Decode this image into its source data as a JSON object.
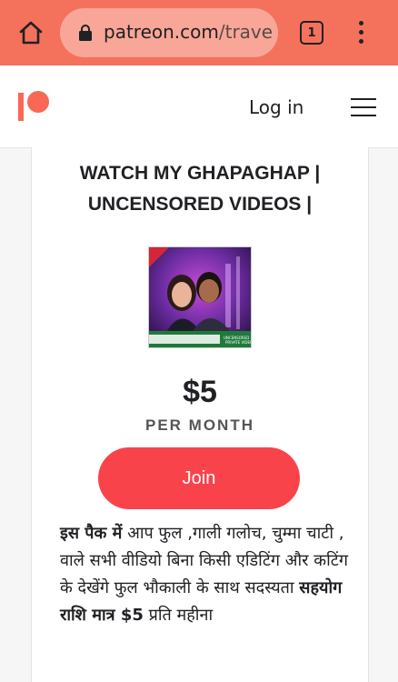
{
  "browser": {
    "url_domain": "patreon.com",
    "url_path": "/trave",
    "tab_count": "1"
  },
  "header": {
    "login_label": "Log in"
  },
  "tier": {
    "title_line1": "WATCH MY GHAPAGHAP |",
    "title_line2": "UNCENSORED VIDEOS |",
    "price": "$5",
    "period": "PER MONTH",
    "join_label": "Join",
    "thumbnail_caption": "UNCENSORED PRIVATE VIDEOS",
    "description": {
      "bold1": "इस पैक में",
      "text1": " आप फुल ,गाली गलोच, चुम्मा चाटी , वाले सभी वीडियो बिना किसी एडिटिंग और कटिंग के देखेंगे फुल भौकाली के साथ सदस्यता ",
      "bold2": "सहयोग राशि मात्र $5",
      "text2": " प्रति महीना"
    }
  },
  "colors": {
    "browser_bar": "#f4725c",
    "brand": "#f96854",
    "join_button": "#f9434b"
  }
}
